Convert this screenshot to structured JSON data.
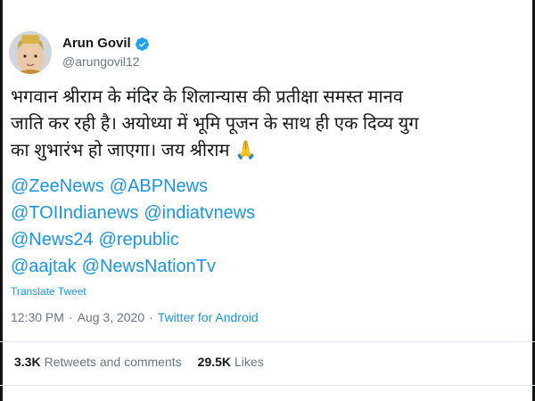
{
  "user": {
    "display_name": "Arun Govil",
    "handle": "@arungovil12",
    "verified": true
  },
  "tweet": {
    "lines": [
      "भगवान श्रीराम के मंदिर के शिलान्यास की प्रतीक्षा समस्त मानव",
      "जाति कर रही है। अयोध्या में भूमि पूजन के साथ ही एक दिव्य युग",
      "का शुभारंभ हो जाएगा। जय श्रीराम 🙏"
    ],
    "mentions": [
      [
        "@ZeeNews",
        "@ABPNews"
      ],
      [
        "@TOIIndianews",
        "@indiatvnews"
      ],
      [
        "@News24",
        "@republic"
      ],
      [
        "@aajtak",
        "@NewsNationTv"
      ]
    ],
    "translate_label": "Translate Tweet",
    "time": "12:30 PM",
    "separator": "·",
    "date": "Aug 3, 2020",
    "source": "Twitter for Android"
  },
  "stats": {
    "retweets_count": "3.3K",
    "retweets_label": "Retweets and comments",
    "likes_count": "29.5K",
    "likes_label": "Likes"
  },
  "colors": {
    "link": "#1b95e0",
    "muted": "#657786",
    "text": "#14171a",
    "verified": "#1da1f2"
  }
}
